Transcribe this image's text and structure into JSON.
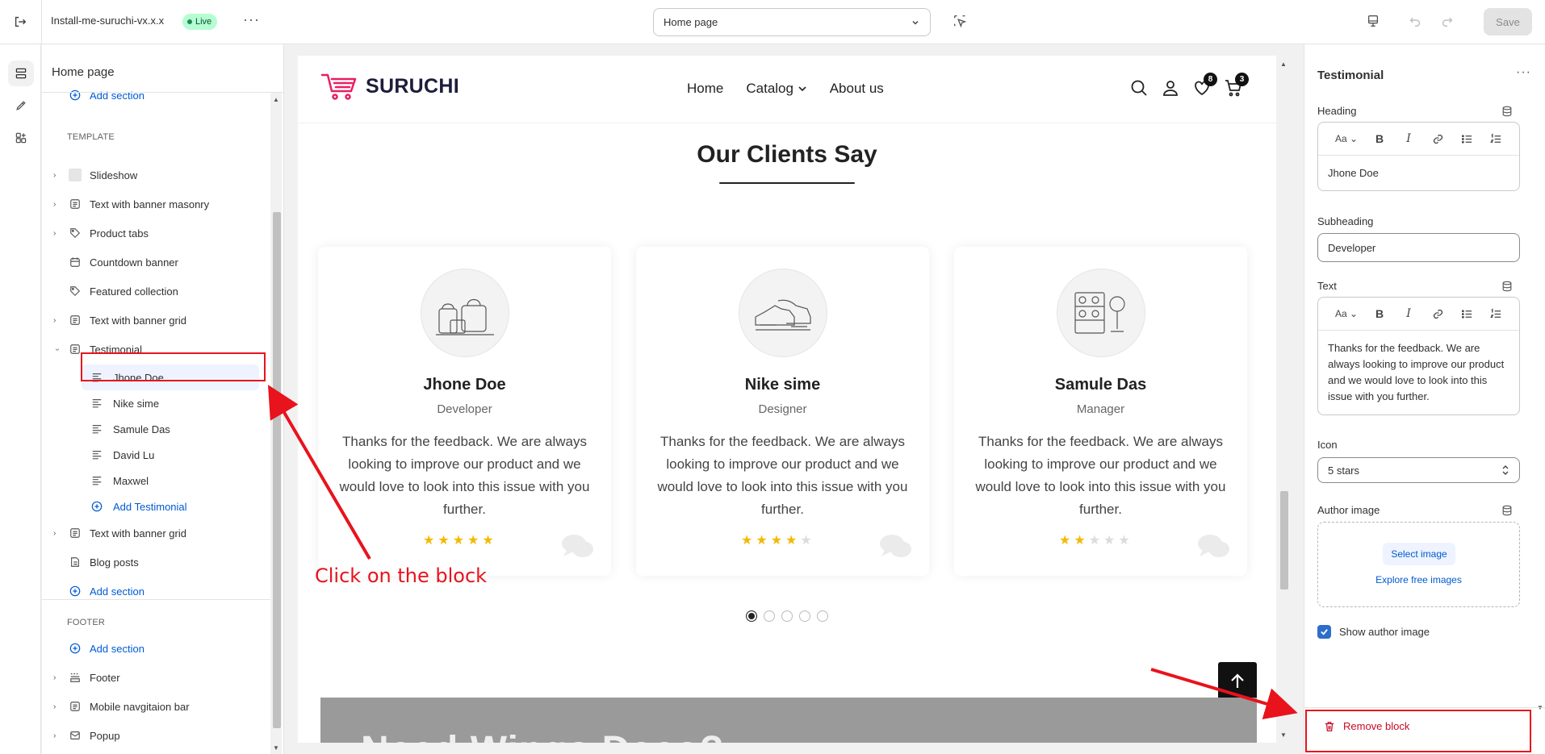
{
  "topbar": {
    "store_name": "Install-me-suruchi-vx.x.x",
    "status_badge": "Live",
    "page_selector": "Home page",
    "save_label": "Save"
  },
  "left_panel": {
    "title": "Home page",
    "add_section_top": "Add section",
    "template_label": "TEMPLATE",
    "sections": [
      {
        "label": "Slideshow",
        "icon": "image-thumb-icon",
        "expandable": true
      },
      {
        "label": "Text with banner masonry",
        "icon": "section-icon",
        "expandable": true
      },
      {
        "label": "Product tabs",
        "icon": "tag-icon",
        "expandable": true
      },
      {
        "label": "Countdown banner",
        "icon": "calendar-icon",
        "expandable": false
      },
      {
        "label": "Featured collection",
        "icon": "tag-icon",
        "expandable": false
      },
      {
        "label": "Text with banner grid",
        "icon": "section-icon",
        "expandable": true
      },
      {
        "label": "Testimonial",
        "icon": "section-icon",
        "expandable": true,
        "expanded": true
      }
    ],
    "testimonial_blocks": [
      "Jhone Doe",
      "Nike sime",
      "Samule Das",
      "David Lu",
      "Maxwel"
    ],
    "add_testimonial": "Add Testimonial",
    "sections_after": [
      {
        "label": "Text with banner grid",
        "icon": "section-icon",
        "expandable": true
      },
      {
        "label": "Blog posts",
        "icon": "edit-icon",
        "expandable": false
      }
    ],
    "add_section_bottom": "Add section",
    "footer_label": "FOOTER",
    "add_section_footer": "Add section",
    "footer_sections": [
      {
        "label": "Footer",
        "icon": "footer-icon",
        "expandable": true
      },
      {
        "label": "Mobile navgitaion bar",
        "icon": "section-icon",
        "expandable": true
      },
      {
        "label": "Popup",
        "icon": "mail-icon",
        "expandable": true
      }
    ]
  },
  "preview": {
    "logo_text": "SURUCHI",
    "nav": [
      "Home",
      "Catalog",
      "About us"
    ],
    "wishlist_count": "8",
    "cart_count": "3",
    "section_title": "Our Clients Say",
    "testimonials": [
      {
        "name": "Jhone Doe",
        "role": "Developer",
        "text": "Thanks for the feedback. We are always looking to improve our product and we would love to look into this issue with you further.",
        "rating": 5
      },
      {
        "name": "Nike sime",
        "role": "Designer",
        "text": "Thanks for the feedback. We are always looking to improve our product and we would love to look into this issue with you further.",
        "rating": 4
      },
      {
        "name": "Samule Das",
        "role": "Manager",
        "text": "Thanks for the feedback. We are always looking to improve our product and we would love to look into this issue with you further.",
        "rating": 2
      }
    ],
    "pagination_count": 5,
    "pagination_active": 0,
    "next_banner_text": "Need Wings Daco?"
  },
  "right_panel": {
    "title": "Testimonial",
    "heading_label": "Heading",
    "heading_value": "Jhone Doe",
    "subheading_label": "Subheading",
    "subheading_value": "Developer",
    "text_label": "Text",
    "text_value": "Thanks for the feedback. We are always looking to improve our product and we would love to look into this issue with you further.",
    "icon_label": "Icon",
    "icon_value": "5 stars",
    "author_image_label": "Author image",
    "select_image": "Select image",
    "explore_images": "Explore free images",
    "show_author_image": "Show author image",
    "show_author_checked": true,
    "remove_block": "Remove block"
  },
  "annotations": {
    "click_hint": "Click on the block",
    "color": "#e8131c"
  },
  "colors": {
    "accent_blue": "#005bd3",
    "danger": "#c70a24",
    "live_badge_bg": "#b4fed2",
    "star": "#f5b800",
    "logo_pink": "#e91e63"
  }
}
